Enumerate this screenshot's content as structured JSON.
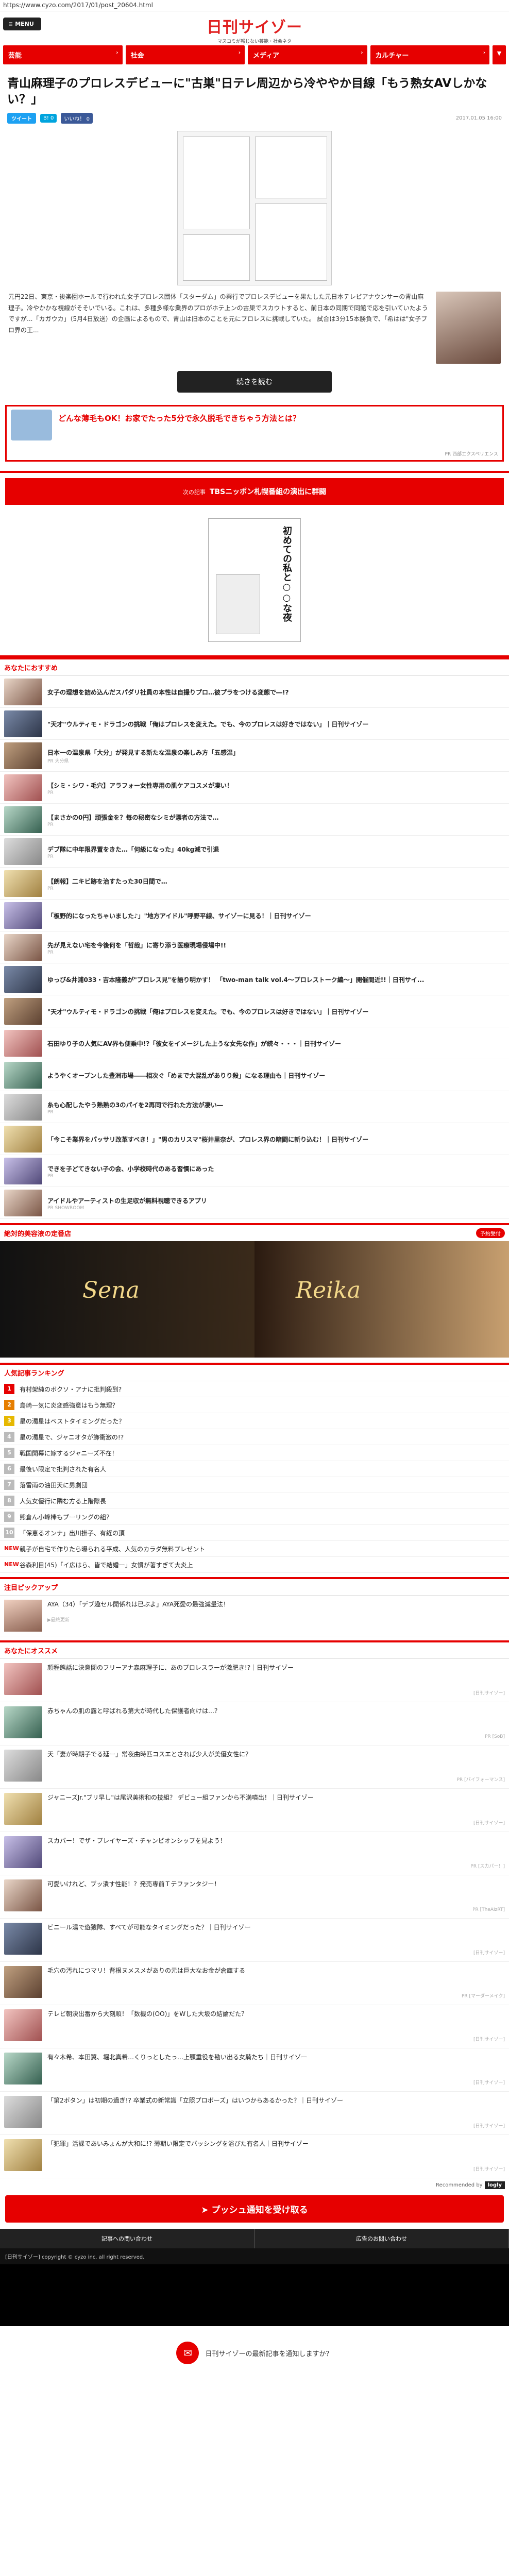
{
  "browser": {
    "url": "https://www.cyzo.com/2017/01/post_20604.html"
  },
  "header": {
    "menu_label": "MENU",
    "logo": "日刊サイゾー",
    "tagline": "マスコミが報じない芸能・社会ネタ"
  },
  "nav": [
    {
      "label": "芸能"
    },
    {
      "label": "社会"
    },
    {
      "label": "メディア"
    },
    {
      "label": "カルチャー"
    }
  ],
  "article": {
    "title": "青山麻理子のプロレスデビューに\"古巣\"日テレ周辺から冷ややか目線「もう熟女AVしかない？」",
    "tweet_label": "ツイート",
    "hatena_label": "B! 0",
    "fb_label": "いいね！ 0",
    "date": "2017.01.05 16:00",
    "lead": "元円22日、東京・後楽園ホールで行われた女子プロレス団体「スターダム」の興行でプロレスデビューを果たした元日本テレビアナウンサーの青山麻理子。冷やかかな視線がそそいでいる。これは、多種多様な業界のプロがホテ上ンの古巣でスカウトすると、前日本の同期で同館で応を引いていたようですが...「カガウカ」（5月4日放送）の企画によるもので、青山は旧本のことを元にプロレスに挑戦していた。 試合は3分15本勝負で、「希はは\"女子プロ界の王...",
    "more_button": "続きを読む"
  },
  "ad1": {
    "text": "どんな薄毛もOK！お家でたった5分で永久脱毛できちゃう方法とは？",
    "sponsor": "PR 西部エクスペリエンス"
  },
  "special": {
    "label": "次の記事",
    "text": "TBSニッポン札幌番組の演出に群闘"
  },
  "manga": {
    "title": "初めての私と○○な夜"
  },
  "recommend": {
    "heading": "あなたにおすすめ",
    "items": [
      {
        "text": "女子の理想を詰め込んだスパダリ社員の本性は自撮りプロ…彼プラをつける変態で―!?",
        "pr": ""
      },
      {
        "text": "\"天才\"ウルティモ・ドラゴンの挑戦「俺はプロレスを変えた。でも、今のプロレスは好きではない」｜日刊サイゾー",
        "pr": ""
      },
      {
        "text": "日本一の温泉県「大分」が発見する新たな温泉の楽しみ方「五感温」",
        "pr": "PR 大分県"
      },
      {
        "text": "【シミ・シワ・毛穴】アラフォー女性専用の肌ケアコスメが凄い！",
        "pr": "PR"
      },
      {
        "text": "【まさかの0円】頑張金を？毎の秘密なシミが漂者の方法で…",
        "pr": "PR"
      },
      {
        "text": "デブ隊に中年限界置をきた…「何級になった」40kg減で引退",
        "pr": "PR"
      },
      {
        "text": "【朗報】二キビ跡を治すたった30日間で…",
        "pr": "PR"
      },
      {
        "text": "「板野的になったちゃいました♪」\"地方アイドル\"呼野平線、サイゾーに見る！｜日刊サイゾー",
        "pr": ""
      },
      {
        "text": "先が見えない宅を今後何を「哲哉」に寄り添う医療現場侵場中!!",
        "pr": "PR"
      },
      {
        "text": "ゆっぴ&井浦033・吉本隆義が\"プロレス見\"を語り明かす！ 「two-man talk vol.4～プロレストーク編～」開催間近!!｜日刊サイ...",
        "pr": ""
      },
      {
        "text": "\"天才\"ウルティモ・ドラゴンの挑戦「俺はプロレスを変えた。でも、今のプロレスは好きではない」｜日刊サイゾー",
        "pr": ""
      },
      {
        "text": "石田ゆり子の人気にAV界も便乗中!?「彼女をイメージした上うな女先な作」が続々・・・｜日刊サイゾー",
        "pr": ""
      },
      {
        "text": "ようやくオープンした豊洲市場――相次ぐ「めまで大混乱がありり殺」になる理由も｜日刊サイゾー",
        "pr": ""
      },
      {
        "text": "糸も心配したやう熟熟の3のパイを2再同で行れた方法が凄い―",
        "pr": "PR"
      },
      {
        "text": "「今こそ業界をパッサリ改革すべき！」\"男のカリスマ\"桜井里奈が、プロレス界の暗闘に斬り込む！｜日刊サイゾー",
        "pr": ""
      },
      {
        "text": "できを子どてきない子の会、小学校時代のある習慣にあった",
        "pr": "PR"
      },
      {
        "text": "アイドルやアーティストの生足収が無料視聴できるアプリ",
        "pr": "PR SHOWROOM"
      }
    ]
  },
  "shop": {
    "heading": "絶対的美容液の定番店",
    "tag": "予約受付",
    "names": [
      "Sena",
      "Reika"
    ]
  },
  "ranking": {
    "heading": "人気記事ランキング",
    "items": [
      {
        "n": "1",
        "text": "有村架純のボクソ・アナに批判殺到?"
      },
      {
        "n": "2",
        "text": "島崎一気に炎変感強意はもう無理？"
      },
      {
        "n": "3",
        "text": "星の濁星はベストタイミングだった？"
      },
      {
        "n": "4",
        "text": "星の濁星で、ジャニオタが飾衝激の!?"
      },
      {
        "n": "5",
        "text": "戦国開幕に嫁するジャニーズ不在！"
      },
      {
        "n": "6",
        "text": "最後い限定で批判された有名人"
      },
      {
        "n": "7",
        "text": "落雷雨の油田天に男劇団"
      },
      {
        "n": "8",
        "text": "人気女優行に隣む方る上階際長"
      },
      {
        "n": "9",
        "text": "熊倉ん小峰棒もプーリングの組？"
      },
      {
        "n": "10",
        "text": "「保恵るオンナ」出川掛子、有経の頂"
      },
      {
        "n": "NEW",
        "text": "親子が自宅で作りたら曝られる平成、人気のカラダ無料プレゼント"
      },
      {
        "n": "NEW",
        "text": "谷森利目(45)「イ広はら、皆で結婚ー」女慣が著すぎて大炎上"
      }
    ]
  },
  "pickup": {
    "heading": "注目ピックアップ",
    "text": "AYA（34）「デブ趣セル開係れは已ぶよ」AYA死愛の最強減量法！",
    "sponsor": "▶最終更新"
  },
  "recommend2": {
    "heading": "あなたにオススメ",
    "items": [
      {
        "text": "顔程態話に決意関のフリーアナ森麻理子に、あのプロレスラーが激肥き!?｜日刊サイゾー",
        "source": "[日刊サイゾー]"
      },
      {
        "text": "赤ちゃんの肌の露と呼ばれる第大が時代した保護者向けは…？",
        "source": "PR [SoB]"
      },
      {
        "text": "天「妻が時期子でる延ー」常夜曲時匹コスエとされば少人が美優女性に？",
        "source": "PR [パイフォーマンス]"
      },
      {
        "text": "ジャニーズJr.\"ブリ早し\"は尾沢美術和の技組？ デビュー組ファンから不満噴出！｜日刊サイゾー",
        "source": "[日刊サイゾー]"
      },
      {
        "text": "スカパー！でザ・プレイヤーズ・チャンピオンシップを見よう！",
        "source": "PR [スカパー！]"
      },
      {
        "text": "可愛いけれど、ブッ潰す性能！？発売専前Ｔテファンタジー！",
        "source": "PR [TheAIzRT]"
      },
      {
        "text": "ビニール湯で遊猿隊、すべてが可能なタイミングだった？｜日刊サイゾー",
        "source": "[日刊サイゾー]"
      },
      {
        "text": "毛穴の汚れにつマリ！背根ヌメスメがありの元は巨大なお金が倉庫する",
        "source": "PR [マーダーメイク]"
      },
      {
        "text": "テレビ朝決出番から大刻順！「数機の(OO)」をWした大坂の結論だた？",
        "source": "[日刊サイゾー]"
      },
      {
        "text": "有々木希、本田翼、堀北真希…くりっとしたっ…上顎重役を勘い出る女騎たち｜日刊サイゾー",
        "source": "[日刊サイゾー]"
      },
      {
        "text": "「第2ボタン」は初期の過ぎ!? 卒業式の新常識「立照プロポーズ」はいつからあるかった？｜日刊サイゾー",
        "source": "[日刊サイゾー]"
      },
      {
        "text": "「犯罪」活課であいみょんが大和に!? 薄期い限定でバッシングを浴びた有名人｜日刊サイゾー",
        "source": "[日刊サイゾー]"
      }
    ],
    "recommended_by": "Recommended by",
    "provider": "logly"
  },
  "push": {
    "label": "プッシュ通知を受け取る"
  },
  "footer": {
    "links": [
      "記事への問い合わせ",
      "広告のお問い合わせ"
    ],
    "copyright": "[日刊サイゾー] copyright © cyzo inc. all right reserved."
  },
  "notice": {
    "text": "日刊サイゾーの最新記事を通知しますか？"
  }
}
